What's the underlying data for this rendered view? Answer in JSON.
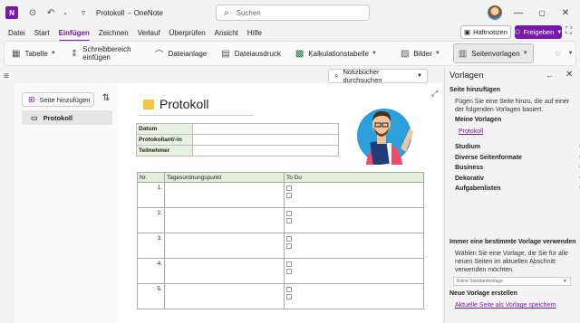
{
  "titlebar": {
    "app_icon": "N",
    "doc_title": "Protokoll",
    "app_name": "OneNote",
    "separator": "-",
    "search_placeholder": "Suchen"
  },
  "menu": {
    "items": [
      "Datei",
      "Start",
      "Einfügen",
      "Zeichnen",
      "Verlauf",
      "Überprüfen",
      "Ansicht",
      "Hilfe"
    ],
    "active": "Einfügen",
    "haftnotizen": "Haftnotizen",
    "freigeben": "Freigeben"
  },
  "ribbon": {
    "tabelle": "Tabelle",
    "schreibbereich": "Schreibbereich einfügen",
    "dateianlage": "Dateianlage",
    "dateiausdruck": "Dateiausdruck",
    "kalkulationstabelle": "Kalkulationstabelle",
    "bilder": "Bilder",
    "seitenvorlagen": "Seitenvorlagen",
    "more": "···"
  },
  "pagelist": {
    "add_page": "Seite hinzufügen",
    "pages": [
      "Protokoll"
    ]
  },
  "notebook_search": "Notizbücher durchsuchen",
  "page": {
    "title": "Protokoll",
    "info_rows": [
      "Datum",
      "Protokollant/-in",
      "Teilnehmer"
    ],
    "agenda": {
      "headers": [
        "Nr.",
        "Tagesordnungspunkt",
        "To Do"
      ],
      "rows": [
        "1.",
        "2.",
        "3.",
        "4.",
        "5."
      ]
    }
  },
  "templates_panel": {
    "title": "Vorlagen",
    "add_heading": "Seite hinzufügen",
    "add_text": "Fügen Sie eine Seite hinzu, die auf einer der folgenden Vorlagen basiert.",
    "my_templates": "Meine Vorlagen",
    "my_template_link": "Protokoll",
    "categories": [
      "Studium",
      "Diverse Seitenformate",
      "Business",
      "Dekorativ",
      "Aufgabenlisten"
    ],
    "default_heading": "Immer eine bestimmte Vorlage verwenden",
    "default_text": "Wählen Sie eine Vorlage, die Sie für alle neuen Seiten im aktuellen Abschnitt verwenden möchten.",
    "default_select": "Keine Standardvorlage",
    "create_heading": "Neue Vorlage erstellen",
    "create_link": "Aktuelle Seite als Vorlage speichern"
  },
  "colors": {
    "accent": "#7719aa",
    "table_header_green": "#e2efd9",
    "folder_yellow": "#f4c542"
  }
}
